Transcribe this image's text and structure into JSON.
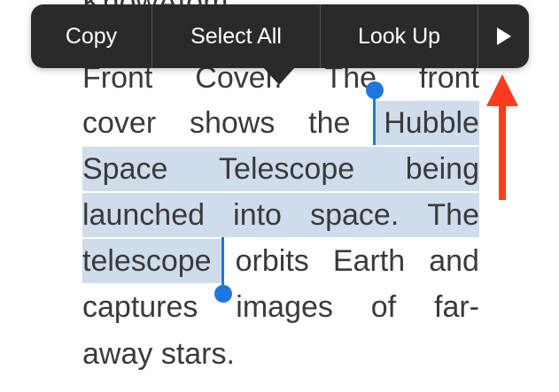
{
  "menu": {
    "copy": "Copy",
    "select_all": "Select All",
    "look_up": "Look Up",
    "more_icon": "play-right-triangle"
  },
  "text": {
    "top_partial": "KnowAtom",
    "line1": [
      "Front",
      "Cover.",
      "The",
      "front"
    ],
    "line2": [
      "cover",
      "shows",
      "the",
      "Hubble"
    ],
    "line3": [
      "Space",
      "Telescope",
      "being"
    ],
    "line4": [
      "launched",
      "into",
      "space.",
      "The"
    ],
    "line5": [
      "telescope",
      "orbits",
      "Earth",
      "and"
    ],
    "line6": [
      "captures",
      "images",
      "of",
      "far-"
    ],
    "line7": "away stars."
  },
  "colors": {
    "selection_highlight": "#cfdcec",
    "selection_handle": "#1f76e0",
    "menu_background": "#2a2a2a",
    "annotation_arrow": "#ff3b1f"
  }
}
